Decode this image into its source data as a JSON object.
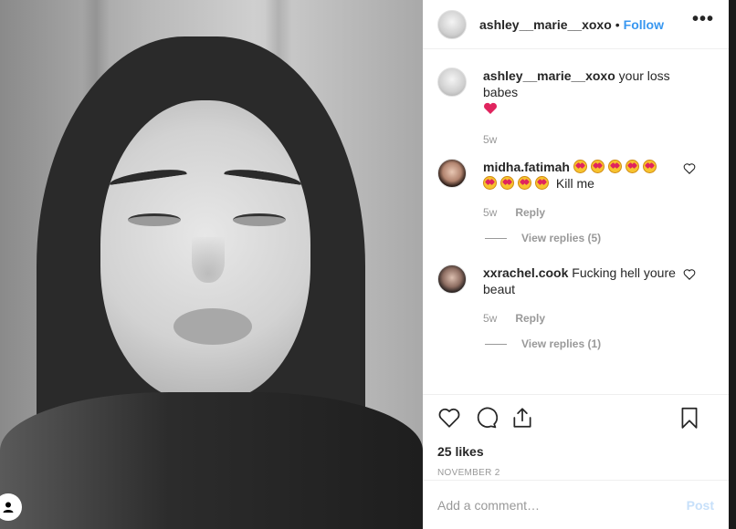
{
  "post": {
    "author": "ashley__marie__xoxo",
    "dot": "•",
    "follow_label": "Follow",
    "more_label": "•••"
  },
  "comments": [
    {
      "username": "ashley__marie__xoxo",
      "text": "your loss babes",
      "time": "5w"
    },
    {
      "username": "midha.fatimah",
      "text_after_emojis": "Kill me",
      "time": "5w",
      "reply_label": "Reply",
      "view_replies": "View replies (5)",
      "emoji_count": 9
    },
    {
      "username": "xxrachel.cook",
      "text": "Fucking hell youre beaut",
      "time": "5w",
      "reply_label": "Reply",
      "view_replies": "View replies (1)"
    }
  ],
  "actions": {
    "likes": "25 likes",
    "date": "NOVEMBER 2"
  },
  "add_comment": {
    "placeholder": "Add a comment…",
    "post_label": "Post"
  },
  "colors": {
    "link_blue": "#3897f0",
    "post_disabled": "#c7e0fa",
    "meta_gray": "#999999"
  }
}
